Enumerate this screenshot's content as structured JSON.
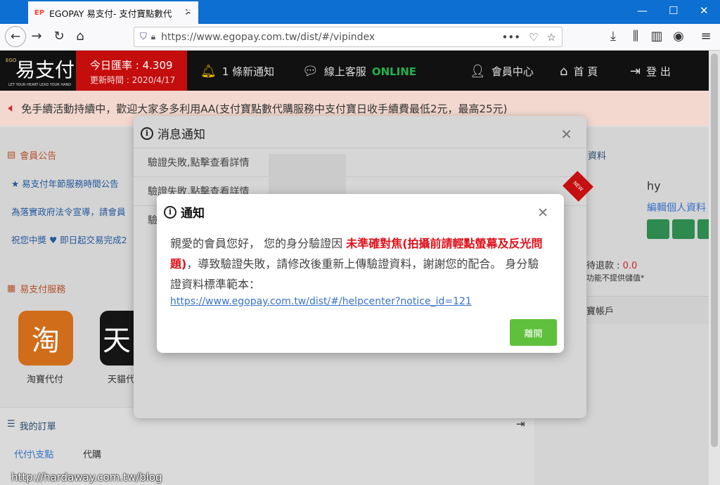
{
  "browser": {
    "tab_title": "EGOPAY 易支付- 支付寶點數代",
    "tab_favicon": "EP",
    "url": "https://www.egopay.com.tw/dist/#/vipindex"
  },
  "header": {
    "logo_text": "易支付",
    "logo_side": "EGO",
    "logo_tagline": "LET YOUR HEART LEAD YOUR HAND",
    "rate_label": "今日匯率 : 4.309",
    "rate_time": "更新時間 : 2020/4/17",
    "notifications": "1 條新通知",
    "support_label": "線上客服",
    "support_status": "ONLINE",
    "member_center": "會員中心",
    "home": "首 頁",
    "logout": "登 出"
  },
  "marquee": "免手續活動持續中，歡迎大家多多利用AA(支付寶點數代購服務中支付寶日收手續費最低2元，最高25元)",
  "left": {
    "announcements_title": "會員公告",
    "announcements": [
      "★ 易支付年節服務時間公告",
      "為落實政府法令宣導，請會員",
      "祝您中獎 ♥ 即日起交易完成2"
    ],
    "services_title": "易支付服務",
    "services": [
      "淘寶代付",
      "天貓代"
    ],
    "service_glyphs": [
      "淘",
      "天"
    ]
  },
  "right": {
    "profile_title": "資料",
    "username": "hy",
    "edit_profile": "編輯個人資料",
    "refund_label": "待退款 :",
    "refund_value": "0.0",
    "refund_note": "功能不提供儲值*",
    "account_title": "寶帳戶"
  },
  "orders": {
    "title": "我的訂單",
    "tabs": [
      "代付\\支點",
      "代購"
    ]
  },
  "message_modal": {
    "title": "消息通知",
    "rows": [
      "驗證失敗,點擊查看詳情",
      "驗證失敗,點擊查看詳情",
      "驗"
    ],
    "ribbon": "NEW"
  },
  "notice_modal": {
    "title": "通知",
    "text_before": "親愛的會員您好， 您的身分驗證因 ",
    "text_red": "未準確對焦(拍攝前請輕點螢幕及反光問題)",
    "text_after": "，導致驗證失敗，請修改後重新上傳驗證資料，謝謝您的配合。 身分驗證資料標準範本：",
    "link": "https://www.egopay.com.tw/dist/#/helpcenter?notice_id=121",
    "button": "離開"
  },
  "watermark": "http://hardaway.com.tw/blog"
}
